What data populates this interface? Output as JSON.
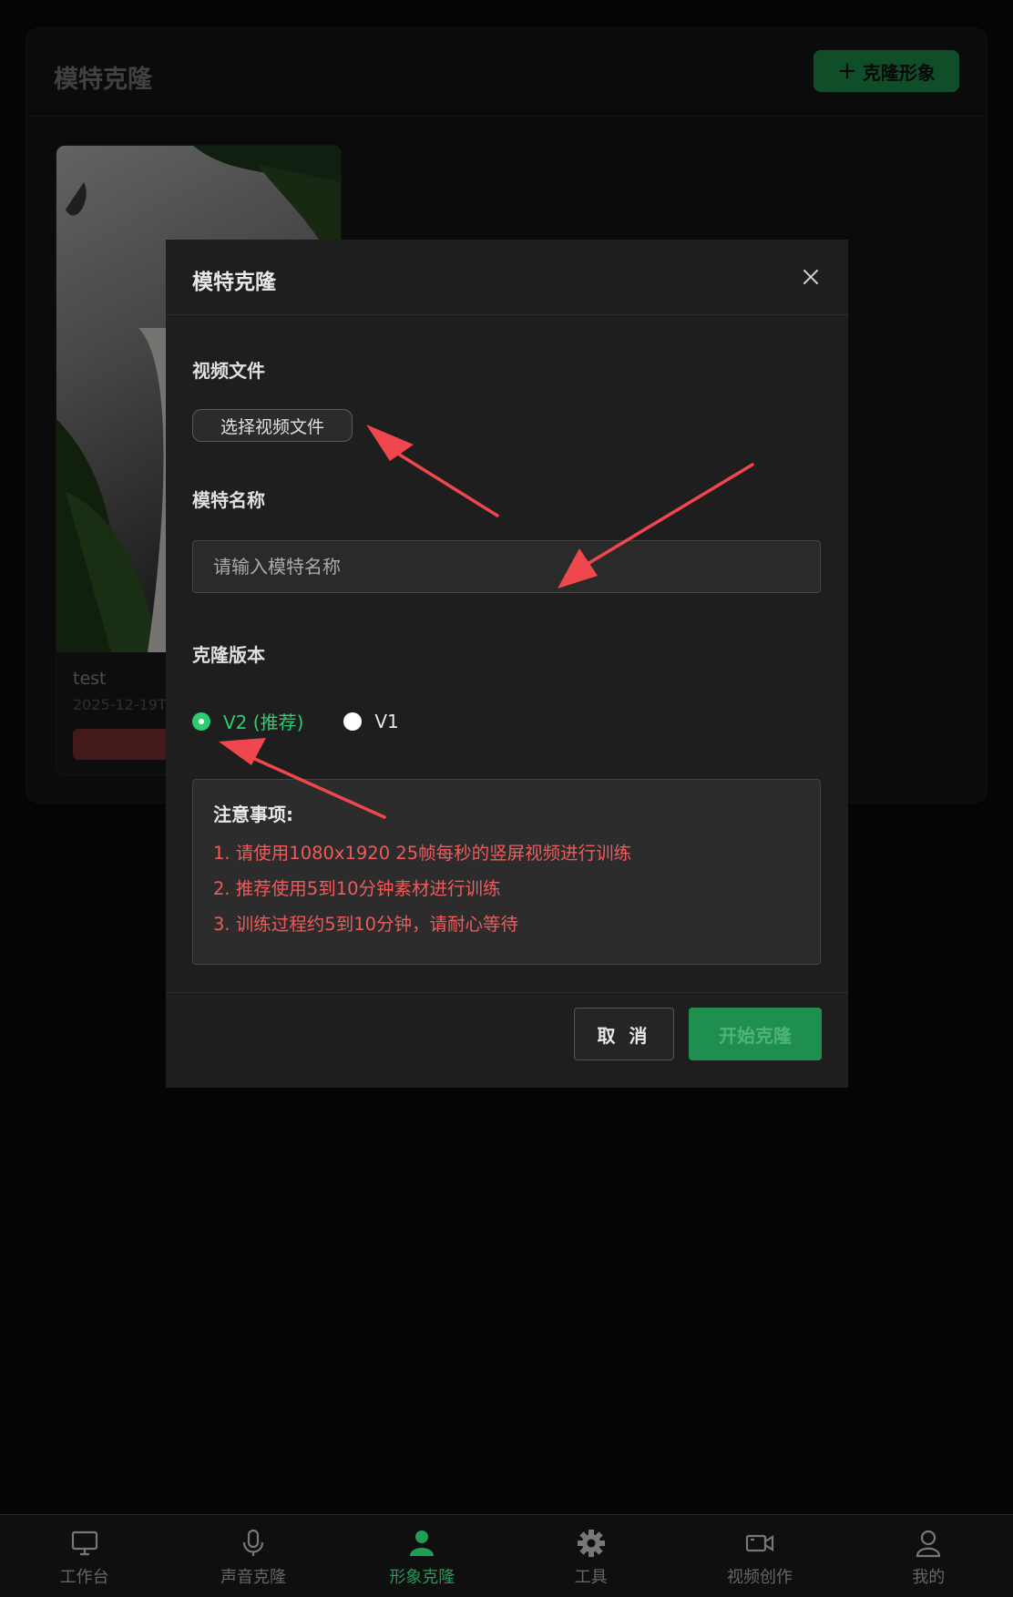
{
  "page": {
    "title": "模特克隆",
    "add_button_label": "克隆形象"
  },
  "model_card": {
    "name": "test",
    "date": "2025-12-19T"
  },
  "modal": {
    "title": "模特克隆",
    "video_file_label": "视频文件",
    "select_file_label": "选择视频文件",
    "model_name_label": "模特名称",
    "model_name_value": "",
    "model_name_placeholder": "请输入模特名称",
    "version_label": "克隆版本",
    "versions": [
      {
        "label": "V2 (推荐)",
        "selected": true
      },
      {
        "label": "V1",
        "selected": false
      }
    ],
    "notes_title": "注意事项:",
    "notes": [
      "1. 请使用1080x1920 25帧每秒的竖屏视频进行训练",
      "2. 推荐使用5到10分钟素材进行训练",
      "3. 训练过程约5到10分钟，请耐心等待"
    ],
    "cancel_label": "取 消",
    "start_label": "开始克隆"
  },
  "tabbar": {
    "items": [
      {
        "label": "工作台",
        "icon": "monitor-icon",
        "active": false
      },
      {
        "label": "声音克隆",
        "icon": "microphone-icon",
        "active": false
      },
      {
        "label": "形象克隆",
        "icon": "person-icon",
        "active": true
      },
      {
        "label": "工具",
        "icon": "gear-icon",
        "active": false
      },
      {
        "label": "视频创作",
        "icon": "video-camera-icon",
        "active": false
      },
      {
        "label": "我的",
        "icon": "user-icon",
        "active": false
      }
    ]
  },
  "colors": {
    "accent": "#1f9d55",
    "warning_text": "#f05a5a",
    "annotation_arrow": "#f0474f"
  }
}
